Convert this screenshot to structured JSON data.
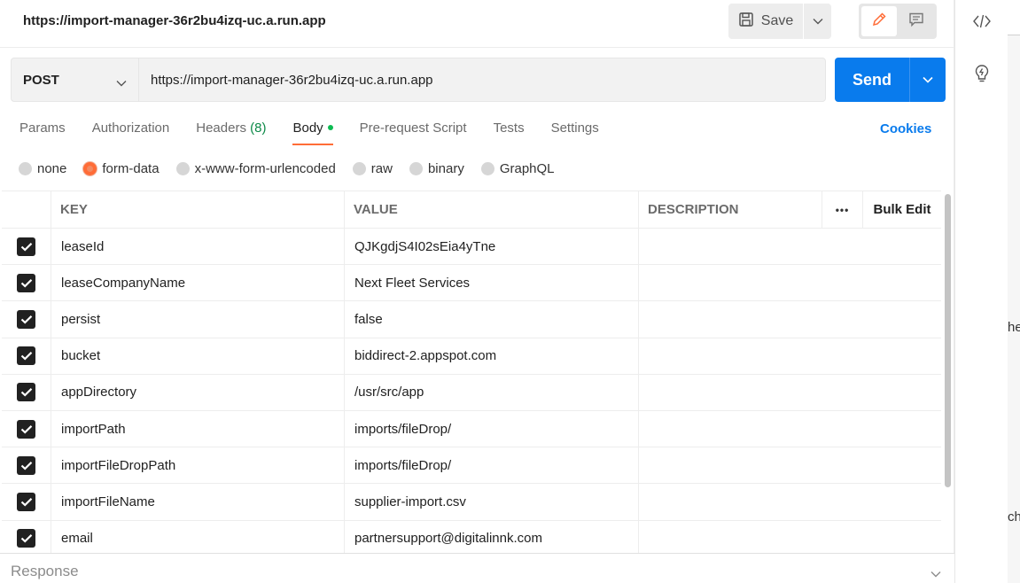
{
  "header": {
    "title": "https://import-manager-36r2bu4izq-uc.a.run.app",
    "save_label": "Save"
  },
  "request": {
    "method": "POST",
    "url": "https://import-manager-36r2bu4izq-uc.a.run.app",
    "send_label": "Send"
  },
  "tabs": [
    {
      "label": "Params"
    },
    {
      "label": "Authorization"
    },
    {
      "label": "Headers",
      "count": "(8)"
    },
    {
      "label": "Body",
      "active": true
    },
    {
      "label": "Pre-request Script"
    },
    {
      "label": "Tests"
    },
    {
      "label": "Settings"
    }
  ],
  "cookies_label": "Cookies",
  "body_types": [
    {
      "label": "none"
    },
    {
      "label": "form-data",
      "checked": true
    },
    {
      "label": "x-www-form-urlencoded"
    },
    {
      "label": "raw"
    },
    {
      "label": "binary"
    },
    {
      "label": "GraphQL"
    }
  ],
  "table": {
    "headers": {
      "key": "KEY",
      "value": "VALUE",
      "description": "DESCRIPTION",
      "more": "•••",
      "bulk_edit": "Bulk Edit"
    },
    "rows": [
      {
        "key": "leaseId",
        "value": "QJKgdjS4I02sEia4yTne",
        "description": ""
      },
      {
        "key": "leaseCompanyName",
        "value": "Next Fleet Services",
        "description": ""
      },
      {
        "key": "persist",
        "value": "false",
        "description": ""
      },
      {
        "key": "bucket",
        "value": "biddirect-2.appspot.com",
        "description": ""
      },
      {
        "key": "appDirectory",
        "value": "/usr/src/app",
        "description": ""
      },
      {
        "key": "importPath",
        "value": "imports/fileDrop/",
        "description": ""
      },
      {
        "key": "importFileDropPath",
        "value": "imports/fileDrop/",
        "description": ""
      },
      {
        "key": "importFileName",
        "value": "supplier-import.csv",
        "description": ""
      },
      {
        "key": "email",
        "value": "partnersupport@digitalinnk.com",
        "description": ""
      }
    ]
  },
  "response_label": "Response",
  "bleed_text": [
    "he",
    "ch"
  ],
  "colors": {
    "accent": "#ff6c37",
    "send": "#097bed",
    "link": "#097bed",
    "count": "#0d8a48"
  }
}
